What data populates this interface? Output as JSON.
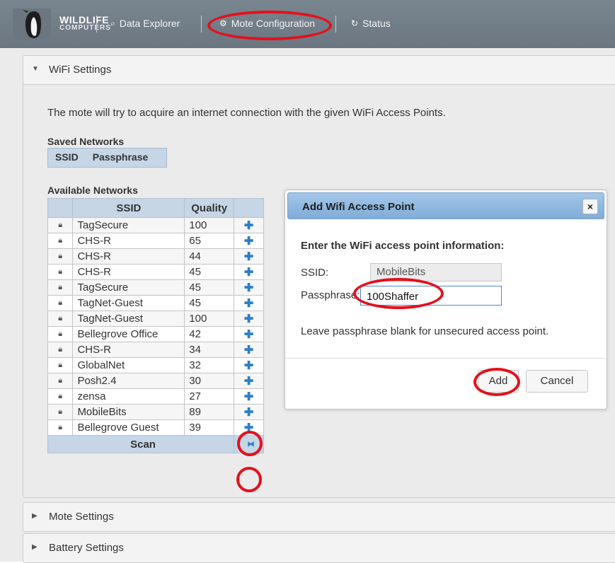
{
  "nav": {
    "brand_line1": "WILDLIFE",
    "brand_line2": "COMPUTERS",
    "data_explorer": "Data Explorer",
    "mote_configuration": "Mote Configuration",
    "status": "Status"
  },
  "accordion": {
    "wifi": "WiFi Settings",
    "mote": "Mote Settings",
    "battery": "Battery Settings"
  },
  "wifi": {
    "intro": "The mote will try to acquire an internet connection with the given WiFi Access Points.",
    "saved_title": "Saved Networks",
    "saved_columns": [
      "SSID",
      "Passphrase"
    ],
    "available_title": "Available Networks",
    "available_columns": [
      "SSID",
      "Quality"
    ],
    "networks": [
      {
        "ssid": "TagSecure",
        "quality": "100"
      },
      {
        "ssid": "CHS-R",
        "quality": "65"
      },
      {
        "ssid": "CHS-R",
        "quality": "44"
      },
      {
        "ssid": "CHS-R",
        "quality": "45"
      },
      {
        "ssid": "TagSecure",
        "quality": "45"
      },
      {
        "ssid": "TagNet-Guest",
        "quality": "45"
      },
      {
        "ssid": "TagNet-Guest",
        "quality": "100"
      },
      {
        "ssid": "Bellegrove Office",
        "quality": "42"
      },
      {
        "ssid": "CHS-R",
        "quality": "34"
      },
      {
        "ssid": "GlobalNet",
        "quality": "32"
      },
      {
        "ssid": "Posh2.4",
        "quality": "30"
      },
      {
        "ssid": "zensa",
        "quality": "27"
      },
      {
        "ssid": "MobileBits",
        "quality": "89"
      },
      {
        "ssid": "Bellegrove Guest",
        "quality": "39"
      }
    ],
    "scan_label": "Scan"
  },
  "dialog": {
    "title": "Add Wifi Access Point",
    "close_glyph": "×",
    "prompt": "Enter the WiFi access point information:",
    "ssid_label": "SSID:",
    "ssid_value": "MobileBits",
    "pass_label": "Passphrase:",
    "pass_value": "100Shaffer",
    "hint": "Leave passphrase blank for unsecured access point.",
    "add_label": "Add",
    "cancel_label": "Cancel"
  },
  "colors": {
    "accent_blue": "#2c7ec8",
    "annotation_red": "#e4101c",
    "header_blue": "#c6d6e6"
  }
}
